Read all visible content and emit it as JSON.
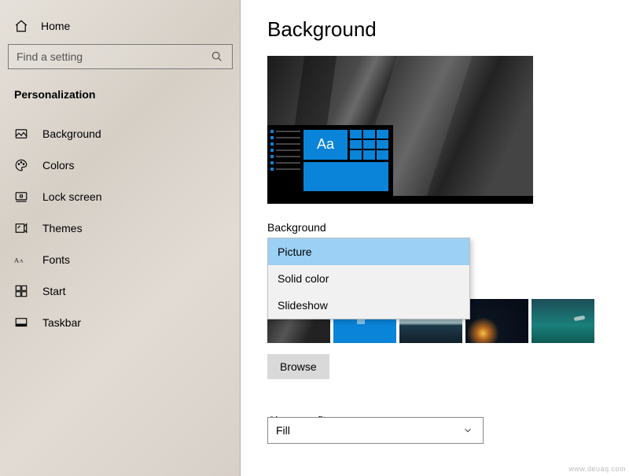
{
  "sidebar": {
    "home_label": "Home",
    "search_placeholder": "Find a setting",
    "section_title": "Personalization",
    "items": [
      {
        "label": "Background",
        "icon": "picture-icon"
      },
      {
        "label": "Colors",
        "icon": "palette-icon"
      },
      {
        "label": "Lock screen",
        "icon": "lockscreen-icon"
      },
      {
        "label": "Themes",
        "icon": "themes-icon"
      },
      {
        "label": "Fonts",
        "icon": "fonts-icon"
      },
      {
        "label": "Start",
        "icon": "start-icon"
      },
      {
        "label": "Taskbar",
        "icon": "taskbar-icon"
      }
    ]
  },
  "main": {
    "title": "Background",
    "preview_sample_text": "Aa",
    "background_label": "Background",
    "background_options": [
      "Picture",
      "Solid color",
      "Slideshow"
    ],
    "background_selected": "Picture",
    "browse_label": "Browse",
    "fit_label": "Choose a fit",
    "fit_selected": "Fill"
  },
  "watermark": "www.deuaq.com"
}
